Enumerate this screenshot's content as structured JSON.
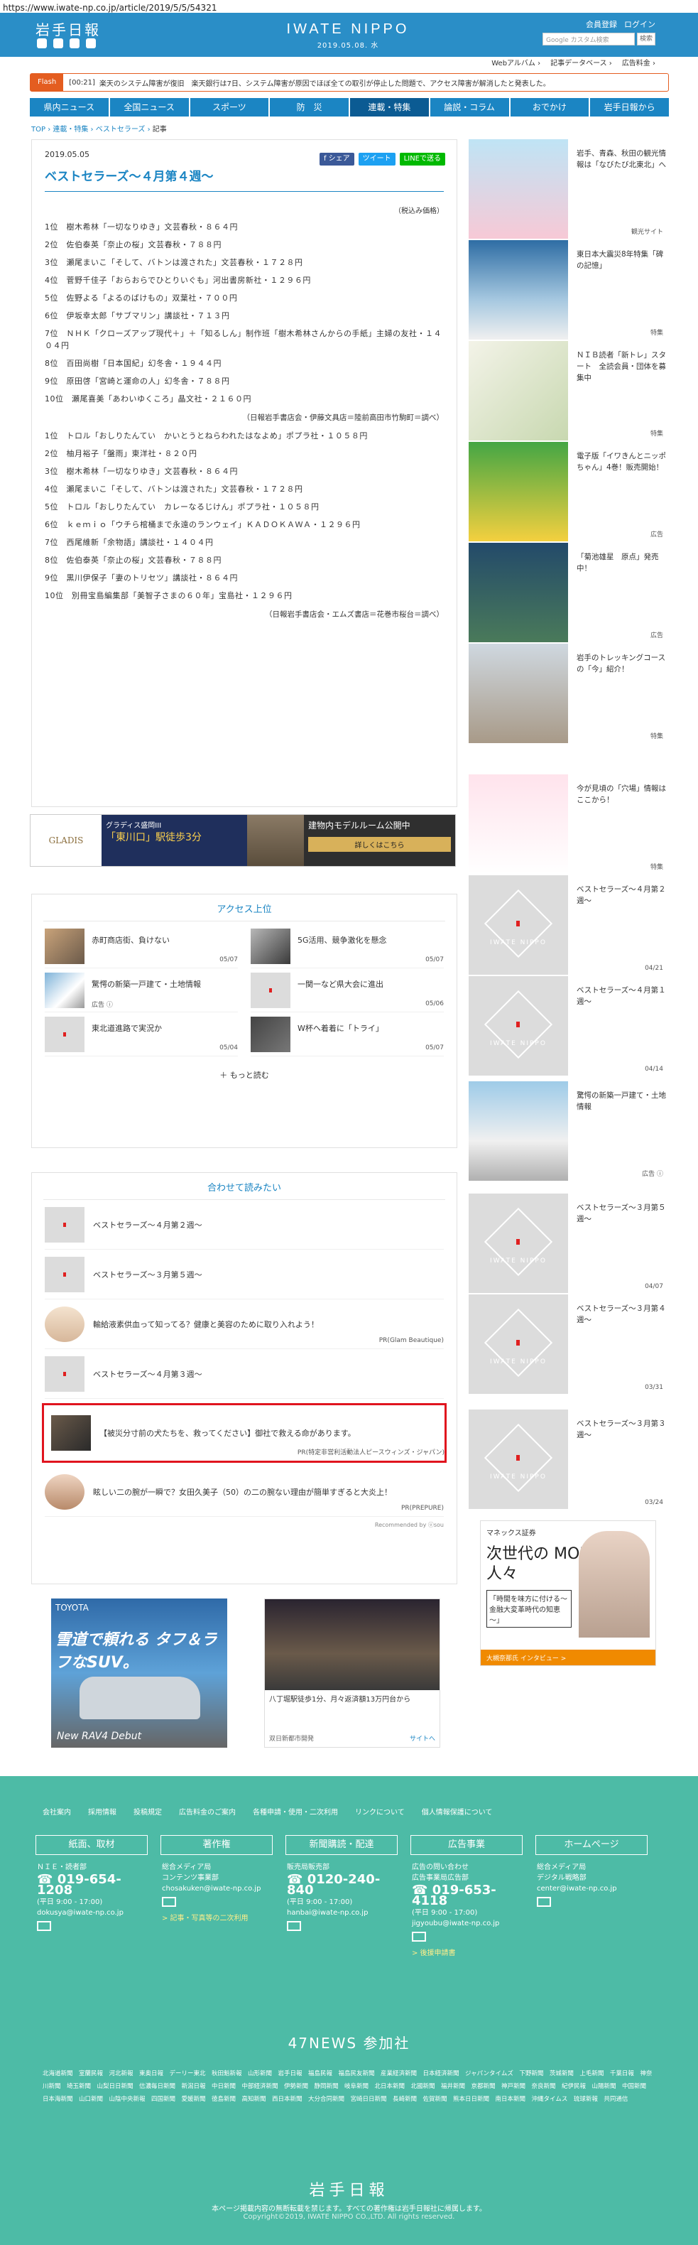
{
  "url": "https://www.iwate-np.co.jp/article/2019/5/5/54321",
  "header": {
    "logo": "岩手日報",
    "brand": "IWATE NIPPO",
    "date": "2019.05.08. 水",
    "links": [
      "会員登録",
      "ログイン"
    ],
    "search_placeholder": "Google カスタム検索",
    "search_button": "検索",
    "sub_links": [
      "Webアルバム ›",
      "記事データベース ›",
      "広告料金 ›"
    ]
  },
  "flash": {
    "tag": "Flash",
    "time": "[00:21]",
    "text": "楽天のシステム障害が復旧　楽天銀行は7日、システム障害が原因でほぼ全ての取引が停止した問題で、アクセス障害が解消したと発表した。"
  },
  "nav": [
    "県内ニュース",
    "全国ニュース",
    "スポーツ",
    "防　災",
    "連載・特集",
    "論説・コラム",
    "おでかけ",
    "岩手日報から"
  ],
  "breadcrumb": [
    "TOP",
    "連載・特集",
    "ベストセラーズ",
    "記事"
  ],
  "article": {
    "date": "2019.05.05",
    "share": [
      "f シェア",
      "ツイート",
      "LINEで送る"
    ],
    "title": "ベストセラーズ～４月第４週～",
    "note": "（税込み価格）",
    "list1": [
      "1位　樹木希林「一切なりゆき」文芸春秋・８６４円",
      "2位　佐伯泰英「奈止の桜」文芸春秋・７８８円",
      "3位　瀬尾まいこ「そして、バトンは渡された」文芸春秋・１７２８円",
      "4位　菅野千佳子「おらおらでひとりいぐも」河出書房新社・１２９６円",
      "5位　佐野よる「よるのばけもの」双葉社・７００円",
      "6位　伊坂幸太郎「サブマリン」講談社・７１３円",
      "7位　ＮＨＫ「クローズアップ現代＋」＋「知るしん」制作班「樹木希林さんからの手紙」主婦の友社・１４０４円",
      "8位　百田尚樹「日本国紀」幻冬舎・１９４４円",
      "9位　原田啓「宮崎と運命の人」幻冬舎・７８８円",
      "10位　瀬尾喜美「あわいゆくころ」晶文社・２１６０円"
    ],
    "src1": "（日報岩手書店会・伊藤文具店＝陸前高田市竹駒町＝調べ）",
    "list2": [
      "1位　トロル「おしりたんてい　かいとうとねらわれたはなよめ」ポプラ社・１０５８円",
      "2位　柚月裕子「盤雨」東洋社・８２０円",
      "3位　樹木希林「一切なりゆき」文芸春秋・８６４円",
      "4位　瀬尾まいこ「そして、バトンは渡された」文芸春秋・１７２８円",
      "5位　トロル「おしりたんてい　カレーなるじけん」ポプラ社・１０５８円",
      "6位　ｋｅｍｉｏ「ウチら棺桶まで永遠のランウェイ」ＫＡＤＯＫＡＷＡ・１２９６円",
      "7位　西尾維新「余物語」講談社・１４０４円",
      "8位　佐伯泰英「奈止の桜」文芸春秋・７８８円",
      "9位　黒川伊保子「妻のトリセツ」講談社・８６４円",
      "10位　別冊宝島編集部「美智子さまの６０年」宝島社・１２９６円"
    ],
    "src2": "（日報岩手書店会・エムズ書店＝花巻市桜台＝調べ）"
  },
  "banner": {
    "brand": "GLADIS",
    "sub": "グラディス盛岡III",
    "headline": "「東川口」駅徒歩3分",
    "promo": "建物内モデルルーム公開中",
    "cta": "詳しくはこちら"
  },
  "access": {
    "title": "アクセス上位",
    "items": [
      {
        "title": "赤町商店街、負けない",
        "date": "05/07",
        "ad": ""
      },
      {
        "title": "5G活用、競争激化を懸念",
        "date": "05/07",
        "ad": ""
      },
      {
        "title": "驚愕の新築一戸建て・土地情報",
        "date": "",
        "ad": "広告 ⓘ"
      },
      {
        "title": "一関一など県大会に進出",
        "date": "05/06",
        "ad": ""
      },
      {
        "title": "東北道進路で実況か",
        "date": "05/04",
        "ad": ""
      },
      {
        "title": "W杯へ着着に「トライ」",
        "date": "05/07",
        "ad": ""
      }
    ],
    "more": "もっと読む"
  },
  "related": {
    "title": "合わせて読みたい",
    "items": [
      {
        "title": "ベストセラーズ～４月第２週～",
        "pr": ""
      },
      {
        "title": "ベストセラーズ～３月第５週～",
        "pr": ""
      },
      {
        "title": "輸給液素供血って知ってる？健康と美容のために取り入れよう！",
        "pr": "PR(Glam Beautique)"
      },
      {
        "title": "ベストセラーズ～４月第３週～",
        "pr": ""
      },
      {
        "title": "【被災分寸前の犬たちを、救ってください】御社で救える命があります。",
        "pr": "PR(特定非営利活動法人ピースウィンズ・ジャパン)"
      },
      {
        "title": "眩しい二の腕が一瞬で？女田久美子（50）の二の腕ない理由が簡単すぎると大炎上！",
        "pr": "PR(PREPURE)"
      }
    ],
    "rec": "Recommended by  ⓤsou"
  },
  "ads": {
    "toyota_brand": "TOYOTA",
    "toyota_copy": "雪道で頼れる タフ＆ラフなSUV。",
    "toyota_model": "New RAV4 Debut",
    "tower_text": "八丁堀駅徒歩1分、月々返済額13万円台から",
    "tower_foot": "双日新都市開発",
    "tower_site": "サイトへ"
  },
  "sidebar": [
    {
      "text": "岩手、青森、秋田の観光情報は「なびたび北東北」へ",
      "tag": "観光サイト"
    },
    {
      "text": "東日本大震災8年特集「碑の記憶」",
      "tag": "特集"
    },
    {
      "text": "ＮＩＢ読者「新トレ」スタート　全読会員・団体を募集中",
      "tag": "特集"
    },
    {
      "text": "電子版「イワきんとニッポちゃん」4巻！販売開始！",
      "tag": "広告"
    },
    {
      "text": "「菊池雄星　原点」発売中！",
      "tag": "広告"
    },
    {
      "text": "岩手のトレッキングコースの「今」紹介！",
      "tag": "特集"
    },
    {
      "text": "今が見頃の「穴場」情報はここから！",
      "tag": "特集"
    },
    {
      "text": "ベストセラーズ～４月第２週～",
      "tag": "04/21"
    },
    {
      "text": "ベストセラーズ～４月第１週～",
      "tag": "04/14"
    },
    {
      "text": "驚愕の新築一戸建て・土地情報",
      "tag": "広告 ⓘ"
    },
    {
      "text": "ベストセラーズ～３月第５週～",
      "tag": "04/07"
    },
    {
      "text": "ベストセラーズ～３月第４週～",
      "tag": "03/31"
    },
    {
      "text": "ベストセラーズ～３月第３週～",
      "tag": "03/24"
    }
  ],
  "monex": {
    "brand": "マネックス証券",
    "copy": "次世代の MONEXな 人々",
    "box": "「時間を味方に付ける～金融大変革時代の知恵～」",
    "bar": "大槻奈那氏 インタビュー >"
  },
  "footer": {
    "links": [
      "会社案内",
      "採用情報",
      "投稿規定",
      "広告料金のご案内",
      "各種申請・使用・二次利用",
      "リンクについて",
      "個人情報保護について"
    ],
    "cols": [
      {
        "head": "紙面、取材",
        "lines": [
          "ＮＩＥ・読者部"
        ],
        "phone": "019-654-1208",
        "hours": "(平日 9:00 - 17:00)",
        "email": "dokusya@iwate-np.co.jp",
        "link": ""
      },
      {
        "head": "著作権",
        "lines": [
          "総合メディア局",
          "コンテンツ事業部"
        ],
        "phone": "",
        "hours": "",
        "email": "chosakuken@iwate-np.co.jp",
        "link": "> 記事・写真等の二次利用"
      },
      {
        "head": "新聞購読・配達",
        "lines": [
          "販売局販売部"
        ],
        "phone": "0120-240-840",
        "hours": "(平日 9:00 - 17:00)",
        "email": "hanbai@iwate-np.co.jp",
        "link": ""
      },
      {
        "head": "広告事業",
        "lines": [
          "広告の問い合わせ",
          "広告事業局広告部"
        ],
        "phone": "019-653-4118",
        "hours": "(平日 9:00 - 17:00)",
        "email": "jigyoubu@iwate-np.co.jp",
        "link": "> 後援申請書"
      },
      {
        "head": "ホームページ",
        "lines": [
          "総合メディア局",
          "デジタル戦略部"
        ],
        "phone": "",
        "hours": "",
        "email": "center@iwate-np.co.jp",
        "link": ""
      }
    ],
    "news47": "47NEWS 参加社",
    "papers": "北海道新聞　室蘭民報　河北新報　東奥日報　デーリー東北　秋田魁新報　山形新聞　岩手日報　福島民報　福島民友新聞　産業経済新聞　日本経済新聞　ジャパンタイムズ　下野新聞　茨城新聞　上毛新聞　千葉日報　神奈川新聞　埼玉新聞　山梨日日新聞　信濃毎日新聞　新潟日報　中日新聞　中部経済新聞　伊勢新聞　静岡新聞　岐阜新聞　北日本新聞　北國新聞　福井新聞　京都新聞　神戸新聞　奈良新聞　紀伊民報　山陽新聞　中国新聞　日本海新聞　山口新聞　山陰中央新報　四国新聞　愛媛新聞　徳島新聞　高知新聞　西日本新聞　大分合同新聞　宮崎日日新聞　長崎新聞　佐賀新聞　熊本日日新聞　南日本新聞　沖縄タイムス　琉球新報　共同通信",
    "logo": "岩手日報",
    "copy": "本ページ掲載内容の無断転載を禁じます。すべての著作権は岩手日報社に帰属します。",
    "copyright": "Copyright©2019, IWATE NIPPO CO.,LTD. All rights reserved."
  }
}
